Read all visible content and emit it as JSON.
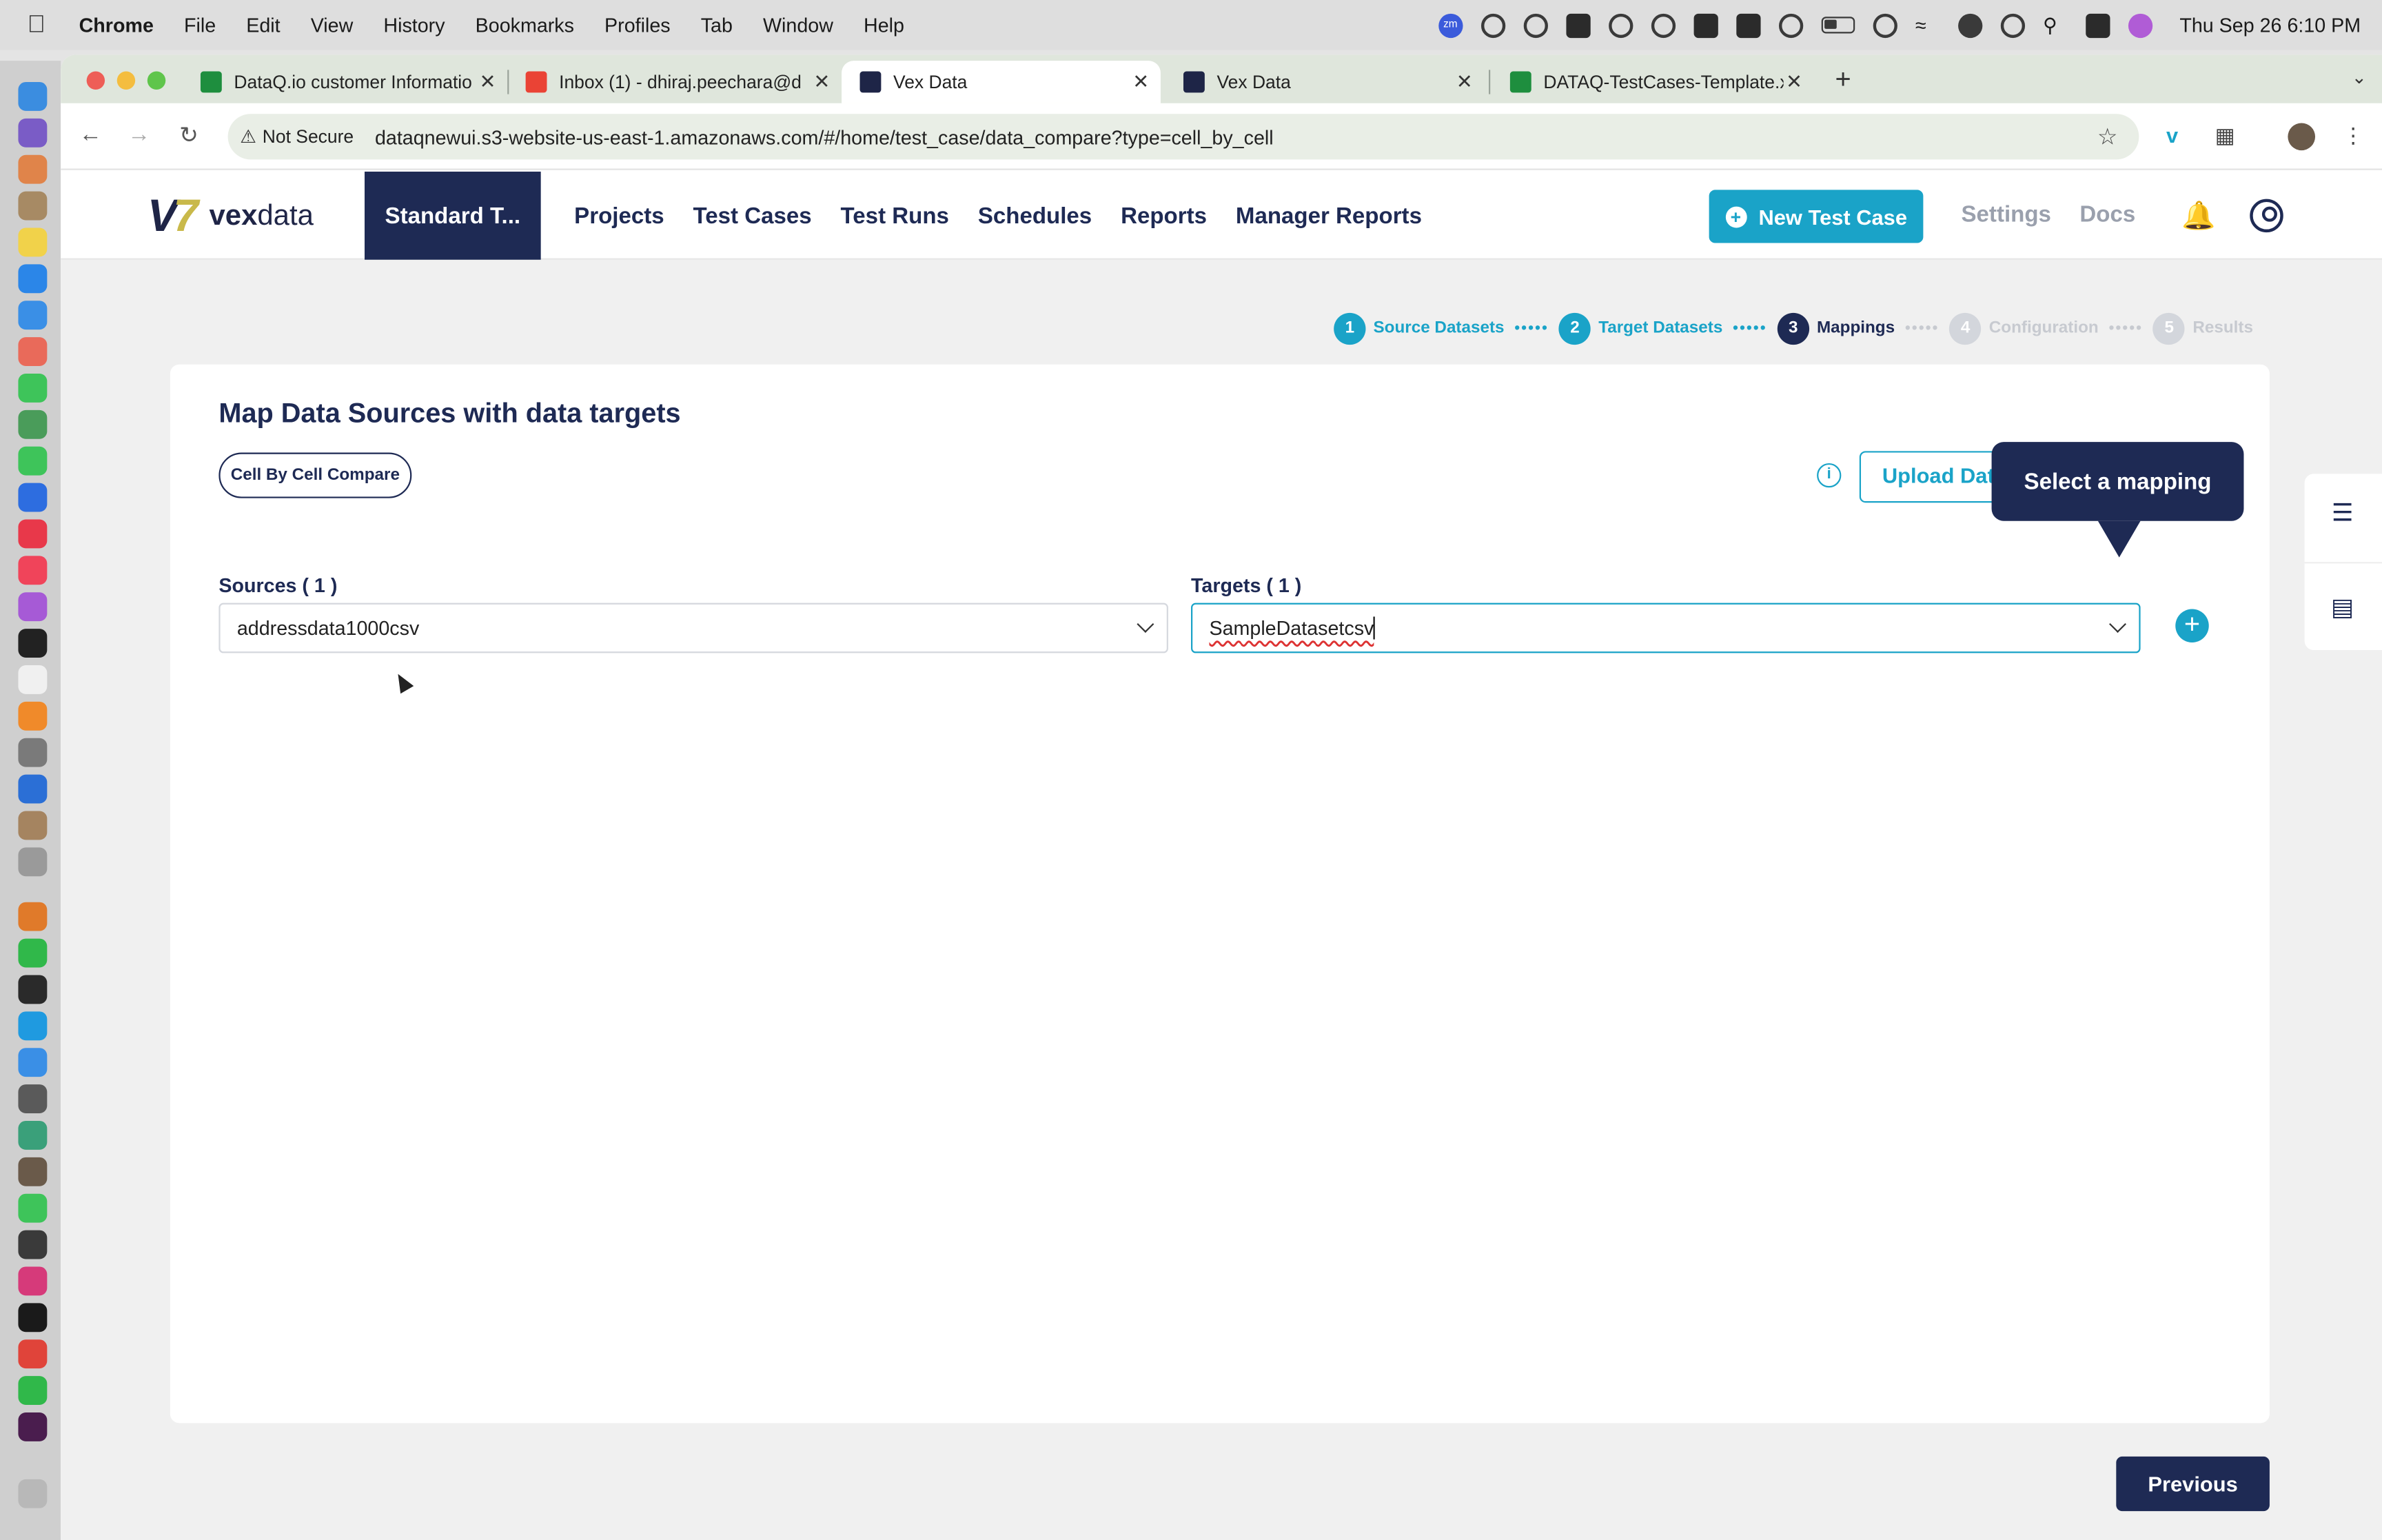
{
  "macos": {
    "app_name": "Chrome",
    "menus": [
      "File",
      "Edit",
      "View",
      "History",
      "Bookmarks",
      "Profiles",
      "Tab",
      "Window",
      "Help"
    ],
    "clock": "Thu Sep 26  6:10 PM",
    "zoom_badge": "zm"
  },
  "browser": {
    "tabs": [
      {
        "title": "DataQ.io customer Informatio",
        "favicon_color": "#1e8e3e"
      },
      {
        "title": "Inbox (1) - dhiraj.peechara@d",
        "favicon_color": "#ea4335"
      },
      {
        "title": "Vex Data",
        "favicon_color": "#1e2547",
        "active": true
      },
      {
        "title": "Vex Data",
        "favicon_color": "#1e2547"
      },
      {
        "title": "DATAQ-TestCases-Template.x",
        "favicon_color": "#1e8e3e"
      }
    ],
    "security_label": "Not Secure",
    "url": "dataqnewui.s3-website-us-east-1.amazonaws.com/#/home/test_case/data_compare?type=cell_by_cell"
  },
  "app": {
    "logo_text_bold": "vex",
    "logo_text": "data",
    "workspace": "Standard T...",
    "nav": [
      "Projects",
      "Test Cases",
      "Test Runs",
      "Schedules",
      "Reports",
      "Manager Reports"
    ],
    "new_test_case_label": "New Test Case",
    "settings_label": "Settings",
    "docs_label": "Docs"
  },
  "stepper": [
    {
      "num": "1",
      "label": "Source Datasets",
      "state": "done"
    },
    {
      "num": "2",
      "label": "Target Datasets",
      "state": "done"
    },
    {
      "num": "3",
      "label": "Mappings",
      "state": "current"
    },
    {
      "num": "4",
      "label": "Configuration",
      "state": "todo"
    },
    {
      "num": "5",
      "label": "Results",
      "state": "todo"
    }
  ],
  "mapping": {
    "title": "Map Data Sources with data targets",
    "compare_type": "Cell By Cell Compare",
    "upload_label": "Upload Data",
    "tooltip": "Select a mapping",
    "sources_label": "Sources ( 1 )",
    "source_value": "addressdata1000csv",
    "targets_label": "Targets ( 1 )",
    "target_value": "SampleDatasetcsv"
  },
  "footer": {
    "previous_label": "Previous"
  },
  "colors": {
    "brand_navy": "#1e2a54",
    "accent_teal": "#1aa3c8"
  }
}
